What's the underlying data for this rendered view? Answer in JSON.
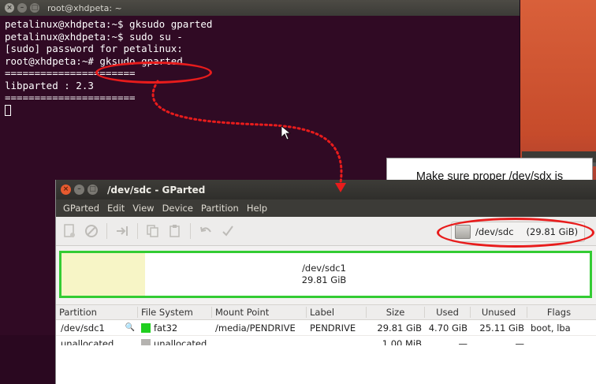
{
  "terminal": {
    "title": "root@xhdpeta: ~",
    "lines": [
      "petalinux@xhdpeta:~$ gksudo gparted",
      "petalinux@xhdpeta:~$ sudo su -",
      "[sudo] password for petalinux:",
      "root@xhdpeta:~# gksudo gparted",
      "======================",
      "libparted : 2.3",
      "======================"
    ]
  },
  "callout": {
    "text": "Make sure proper /dev/sdx is selected"
  },
  "gparted": {
    "title": "/dev/sdc - GParted",
    "menu": [
      "GParted",
      "Edit",
      "View",
      "Device",
      "Partition",
      "Help"
    ],
    "device": {
      "name": "/dev/sdc",
      "size": "(29.81 GiB)"
    },
    "map": {
      "partition": "/dev/sdc1",
      "size": "29.81 GiB"
    },
    "columns": [
      "Partition",
      "File System",
      "Mount Point",
      "Label",
      "Size",
      "Used",
      "Unused",
      "Flags"
    ],
    "rows": [
      {
        "partition": "/dev/sdc1",
        "filesystem": "fat32",
        "mountpoint": "/media/PENDRIVE",
        "label": "PENDRIVE",
        "size": "29.81 GiB",
        "used": "4.70 GiB",
        "unused": "25.11 GiB",
        "flags": "boot, lba",
        "color": "#1fcf1f"
      },
      {
        "partition": "unallocated",
        "filesystem": "unallocated",
        "mountpoint": "",
        "label": "",
        "size": "1.00 MiB",
        "used": "—",
        "unused": "—",
        "flags": "",
        "color": "#b5b3b0"
      }
    ]
  },
  "colors": {
    "annotation": "#e81c1c",
    "terminal_bg": "#300a24",
    "partition_border": "#33cc33"
  }
}
